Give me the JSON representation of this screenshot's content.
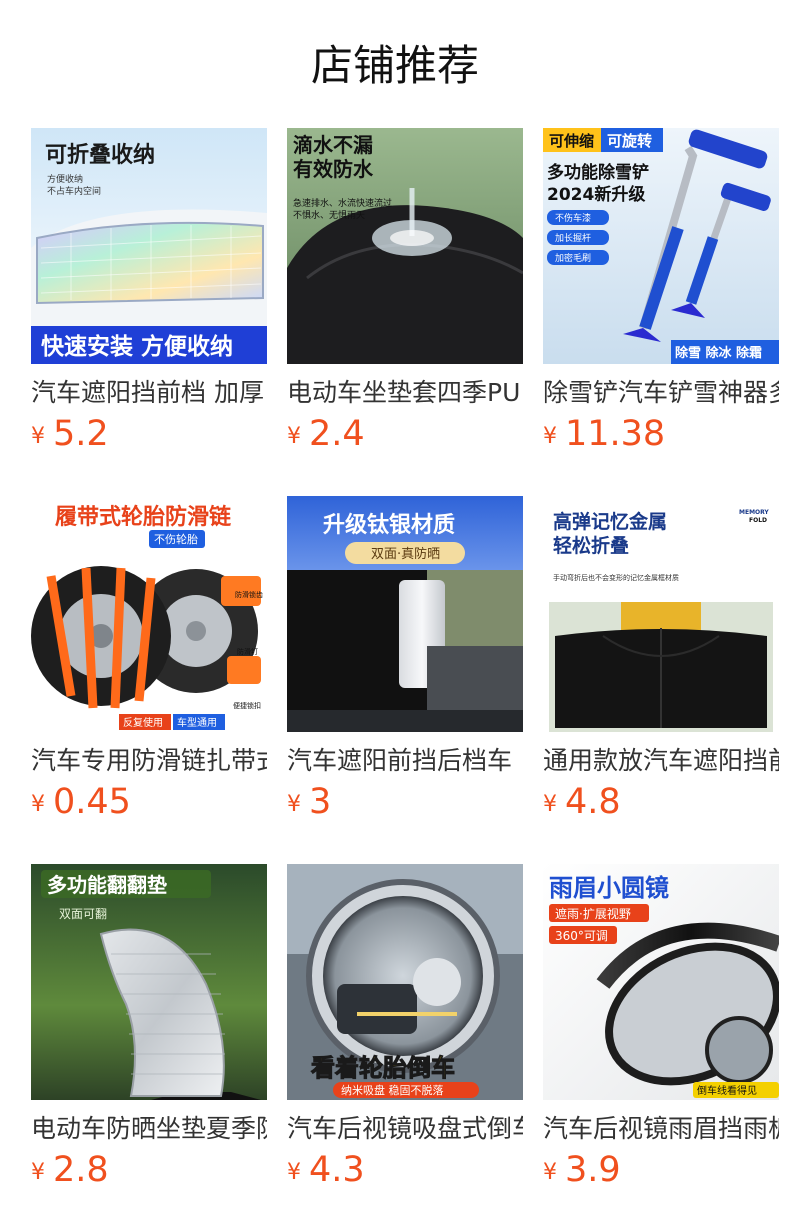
{
  "section": {
    "title": "店铺推荐"
  },
  "currency_symbol": "¥",
  "colors": {
    "price": "#f0501e",
    "title": "#111111",
    "name": "#333333"
  },
  "products": [
    {
      "name": "汽车遮阳挡前档 加厚",
      "price": "5.2",
      "image_text": {
        "headline": "可折叠收纳",
        "sub1": "方便收纳",
        "sub2": "不占车内空间",
        "banner": "快速安装 方便收纳"
      }
    },
    {
      "name": "电动车坐垫套四季PU",
      "price": "2.4",
      "image_text": {
        "headline1": "滴水不漏",
        "headline2": "有效防水",
        "sub1": "急速排水、水流快速流过",
        "sub2": "不惧水、无惧雨天"
      }
    },
    {
      "name": "除雪铲汽车铲雪神器多",
      "price": "11.38",
      "image_text": {
        "tag1": "可伸缩",
        "tag2": "可旋转",
        "headline1": "多功能除雪铲",
        "headline2": "2024新升级",
        "pill1": "不伤车漆",
        "pill2": "加长握杆",
        "pill3": "加密毛刷",
        "banner": "除雪 除冰 除霜"
      }
    },
    {
      "name": "汽车专用防滑链扎带式",
      "price": "0.45",
      "image_text": {
        "headline": "履带式轮胎防滑链",
        "tag": "不伤轮胎",
        "label1": "防滑锁齿",
        "label2": "防滑钉",
        "label3": "便捷锁扣",
        "footer1": "反复使用",
        "footer2": "车型通用"
      }
    },
    {
      "name": "汽车遮阳前挡后档车",
      "price": "3",
      "image_text": {
        "headline": "升级钛银材质",
        "banner": "双面·真防晒"
      }
    },
    {
      "name": "通用款放汽车遮阳挡前",
      "price": "4.8",
      "image_text": {
        "headline1": "高弹记忆金属",
        "headline2": "轻松折叠",
        "brand1": "MEMORY",
        "brand2": "FOLD",
        "sub": "手动弯折后也不会变形的记忆金属框材质"
      }
    },
    {
      "name": "电动车防晒坐垫夏季防",
      "price": "2.8",
      "image_text": {
        "headline": "多功能翻翻垫",
        "tag": "双面可翻"
      }
    },
    {
      "name": "汽车后视镜吸盘式倒车",
      "price": "4.3",
      "image_text": {
        "headline": "看着轮胎倒车",
        "banner": "纳米吸盘 稳固不脱落"
      }
    },
    {
      "name": "汽车后视镜雨眉挡雨板",
      "price": "3.9",
      "image_text": {
        "headline": "雨眉小圆镜",
        "tag1": "遮雨·扩展视野",
        "tag2": "360°可调",
        "badge": "倒车线看得见"
      }
    }
  ]
}
